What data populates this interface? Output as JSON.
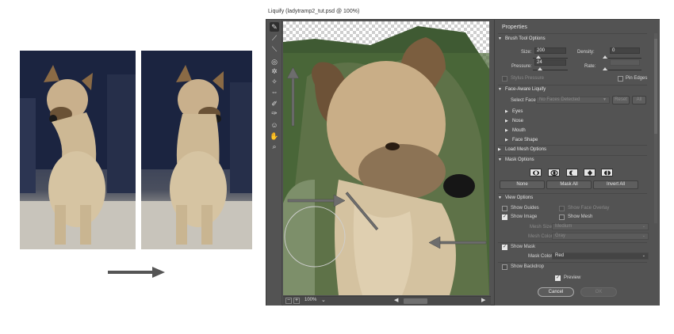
{
  "window_title": "Liquify (ladytramp2_tut.psd @ 100%)",
  "tools": [
    "forward-warp-icon",
    "reconstruct-icon",
    "smooth-icon",
    "twirl-icon",
    "pucker-icon",
    "bloat-icon",
    "push-left-icon",
    "freeze-mask-icon",
    "thaw-mask-icon",
    "face-tool-icon",
    "hand-icon",
    "zoom-icon"
  ],
  "status": {
    "zoom": "100%",
    "zoom_out": "−",
    "zoom_in": "+",
    "chevron": "⌄",
    "left": "◀",
    "right": "▶"
  },
  "panel": {
    "title": "Properties",
    "brush": {
      "header": "Brush Tool Options",
      "size_label": "Size:",
      "size_value": "200",
      "density_label": "Density:",
      "density_value": "0",
      "pressure_label": "Pressure:",
      "pressure_value": "24",
      "rate_label": "Rate:",
      "rate_value": "",
      "stylus_label": "Stylus Pressure",
      "pin_edges_label": "Pin Edges"
    },
    "face": {
      "header": "Face-Aware Liquify",
      "select_face_label": "Select Face:",
      "select_face_value": "No Faces Detected",
      "reset_label": "Reset",
      "all_label": "All",
      "items": [
        "Eyes",
        "Nose",
        "Mouth",
        "Face Shape"
      ]
    },
    "load_mesh_header": "Load Mesh Options",
    "mask": {
      "header": "Mask Options",
      "none_label": "None",
      "mask_all_label": "Mask All",
      "invert_all_label": "Invert All"
    },
    "view": {
      "header": "View Options",
      "show_guides": "Show Guides",
      "show_face_overlay": "Show Face Overlay",
      "show_image": "Show Image",
      "show_mesh": "Show Mesh",
      "mesh_size_label": "Mesh Size:",
      "mesh_size_value": "Medium",
      "mesh_color_label": "Mesh Color:",
      "mesh_color_value": "Gray",
      "show_mask": "Show Mask",
      "mask_color_label": "Mask Color:",
      "mask_color_value": "Red",
      "show_backdrop": "Show Backdrop"
    },
    "preview_label": "Preview",
    "cancel_label": "Cancel",
    "ok_label": "OK"
  },
  "colors": {
    "panel_bg": "#535353",
    "mask_color": "Red"
  }
}
